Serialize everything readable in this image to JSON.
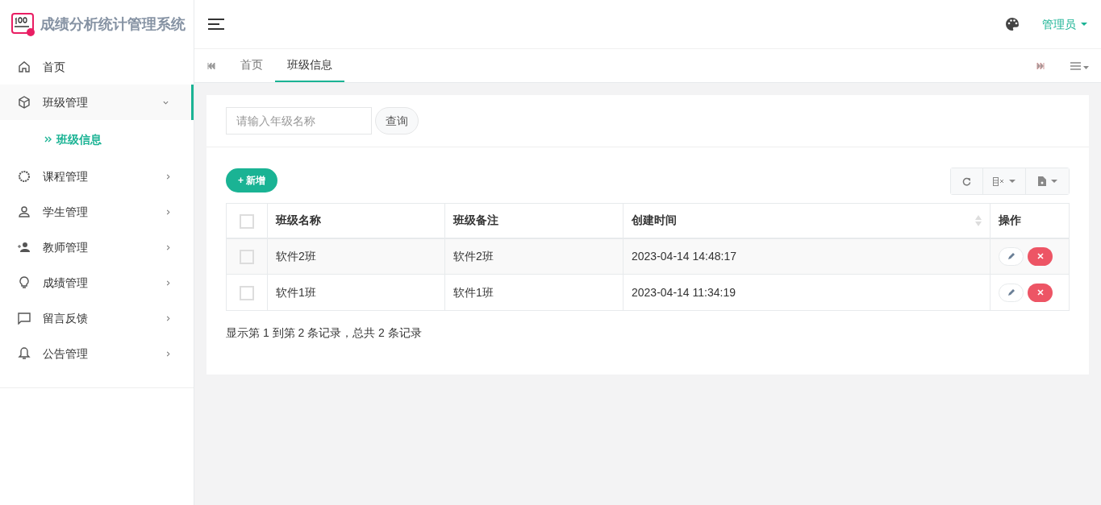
{
  "app": {
    "title": "成绩分析统计管理系统"
  },
  "header": {
    "user": "管理员"
  },
  "sidebar": {
    "items": [
      {
        "label": "首页",
        "selected": false
      },
      {
        "label": "班级管理",
        "selected": true,
        "expanded": true,
        "children": [
          {
            "label": "班级信息",
            "selected": true
          }
        ]
      },
      {
        "label": "课程管理",
        "selected": false,
        "expanded": false
      },
      {
        "label": "学生管理",
        "selected": false,
        "expanded": false
      },
      {
        "label": "教师管理",
        "selected": false,
        "expanded": false
      },
      {
        "label": "成绩管理",
        "selected": false,
        "expanded": false
      },
      {
        "label": "留言反馈",
        "selected": false,
        "expanded": false
      },
      {
        "label": "公告管理",
        "selected": false,
        "expanded": false
      }
    ]
  },
  "tabs": [
    {
      "label": "首页",
      "selected": false
    },
    {
      "label": "班级信息",
      "selected": true
    }
  ],
  "search": {
    "placeholder": "请输入年级名称",
    "button": "查询"
  },
  "add_button": "+ 新增",
  "table": {
    "all_checked": false,
    "columns": [
      {
        "label": "班级名称",
        "sortable": false
      },
      {
        "label": "班级备注",
        "sortable": false
      },
      {
        "label": "创建时间",
        "sortable": true
      },
      {
        "label": "操作",
        "sortable": false
      }
    ],
    "rows": [
      {
        "checked": false,
        "cells": [
          "软件2班",
          "软件2班",
          "2023-04-14 14:48:17"
        ]
      },
      {
        "checked": false,
        "cells": [
          "软件1班",
          "软件1班",
          "2023-04-14 11:34:19"
        ]
      }
    ]
  },
  "pagination_info": "显示第 1 到第 2 条记录，总共 2 条记录"
}
